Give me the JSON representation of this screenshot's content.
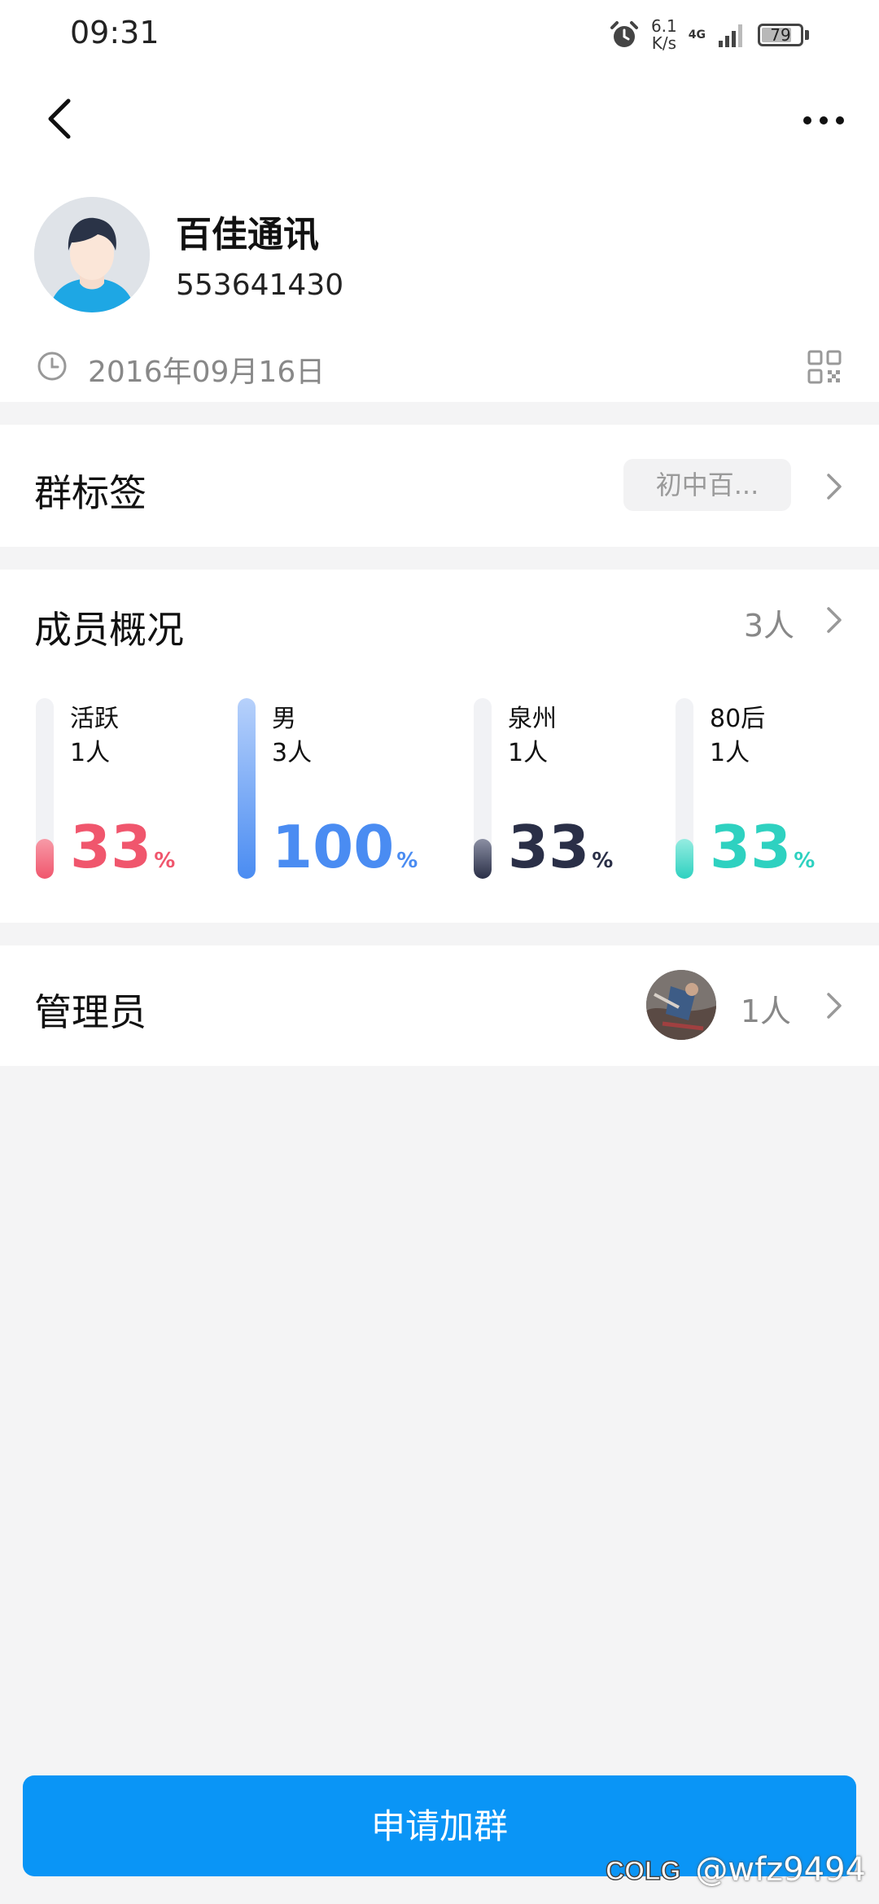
{
  "status_bar": {
    "time": "09:31",
    "net_speed_value": "6.1",
    "net_speed_unit": "K/s",
    "network_type": "4G",
    "battery_level": 79,
    "battery_text": "79"
  },
  "header": {
    "back_icon": "chevron-left-icon",
    "more_icon": "more-horizontal-icon"
  },
  "group": {
    "name": "百佳通讯",
    "id": "553641430",
    "created_date": "2016年09月16日"
  },
  "tags": {
    "title": "群标签",
    "chip": "初中百..."
  },
  "members": {
    "title": "成员概况",
    "count": "3人",
    "stats": [
      {
        "label": "活跃",
        "count": "1人",
        "percent": "33",
        "percent_sign": "%",
        "fill_fraction": 0.33,
        "color": "#f0566d",
        "color_light": "#f79aa7"
      },
      {
        "label": "男",
        "count": "3人",
        "percent": "100",
        "percent_sign": "%",
        "fill_fraction": 1.0,
        "color": "#4a8cf2",
        "color_light": "#b7d1fb"
      },
      {
        "label": "泉州",
        "count": "1人",
        "percent": "33",
        "percent_sign": "%",
        "fill_fraction": 0.33,
        "color": "#2a2f47",
        "color_light": "#8b8fa3"
      },
      {
        "label": "80后",
        "count": "1人",
        "percent": "33",
        "percent_sign": "%",
        "fill_fraction": 0.33,
        "color": "#2ed1c0",
        "color_light": "#95ece1"
      }
    ]
  },
  "admins": {
    "title": "管理员",
    "count": "1人"
  },
  "join_button": {
    "label": "申请加群"
  },
  "watermark": {
    "logo_text": "COLG",
    "text": "@wfz9494"
  },
  "colors": {
    "primary": "#0a95f6",
    "background": "#f4f4f5"
  }
}
